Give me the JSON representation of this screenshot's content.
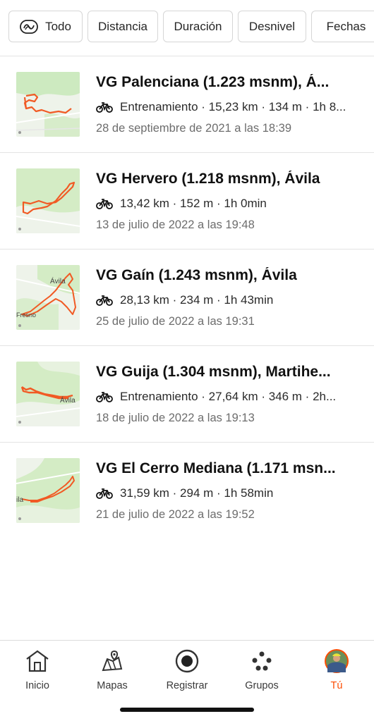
{
  "filters": {
    "all_label": "Todo",
    "distance_label": "Distancia",
    "duration_label": "Duración",
    "elevation_label": "Desnivel",
    "dates_label": "Fechas"
  },
  "activities": [
    {
      "title": "VG Palenciana (1.223 msnm), Á...",
      "stats": "Entrenamiento · 15,23 km · 134 m · 1h 8...",
      "date": "28 de septiembre de 2021 a las 18:39",
      "map_labels": []
    },
    {
      "title": "VG Hervero (1.218 msnm), Ávila",
      "stats": "13,42 km · 152 m · 1h 0min",
      "date": "13 de julio de 2022 a las 19:48",
      "map_labels": []
    },
    {
      "title": "VG Gaín (1.243 msnm), Ávila",
      "stats": "28,13 km · 234 m · 1h 43min",
      "date": "25 de julio de 2022 a las 19:31",
      "map_labels": [
        "Ávila",
        "Fresno"
      ]
    },
    {
      "title": "VG Guija (1.304 msnm), Martihe...",
      "stats": "Entrenamiento · 27,64 km · 346 m · 2h...",
      "date": "18 de julio de 2022 a las 19:13",
      "map_labels": [
        "Ávila"
      ]
    },
    {
      "title": "VG El Cerro Mediana (1.171 msn...",
      "stats": "31,59 km · 294 m · 1h 58min",
      "date": "21 de julio de 2022 a las 19:52",
      "map_labels": [
        "ila"
      ]
    }
  ],
  "tabs": [
    {
      "label": "Inicio",
      "icon": "home-icon"
    },
    {
      "label": "Mapas",
      "icon": "map-icon"
    },
    {
      "label": "Registrar",
      "icon": "record-icon"
    },
    {
      "label": "Grupos",
      "icon": "groups-icon"
    },
    {
      "label": "Tú",
      "icon": "avatar",
      "active": true
    }
  ],
  "colors": {
    "accent": "#fc4c02",
    "route": "#f15a24",
    "map_green": "#cdeac0",
    "map_bg": "#eef3ea"
  }
}
